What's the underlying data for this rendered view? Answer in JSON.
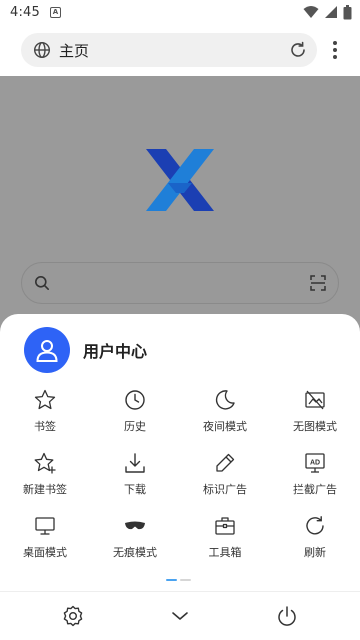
{
  "status_bar": {
    "time": "4:45",
    "notification_badge": "A"
  },
  "address_bar": {
    "title": "主页",
    "left_icon": "globe-icon",
    "right_icon": "refresh-icon"
  },
  "page": {
    "logo": "x-browser-logo",
    "search_placeholder": ""
  },
  "sheet": {
    "user": {
      "label": "用户中心",
      "avatar_icon": "user-icon"
    },
    "items": [
      {
        "label": "书签",
        "icon": "star-icon"
      },
      {
        "label": "历史",
        "icon": "clock-icon"
      },
      {
        "label": "夜间模式",
        "icon": "moon-icon"
      },
      {
        "label": "无图模式",
        "icon": "no-image-icon"
      },
      {
        "label": "新建书签",
        "icon": "star-plus-icon"
      },
      {
        "label": "下载",
        "icon": "download-icon"
      },
      {
        "label": "标识广告",
        "icon": "pencil-icon"
      },
      {
        "label": "拦截广告",
        "icon": "ad-block-icon"
      },
      {
        "label": "桌面模式",
        "icon": "monitor-icon"
      },
      {
        "label": "无痕模式",
        "icon": "mask-icon"
      },
      {
        "label": "工具箱",
        "icon": "toolbox-icon"
      },
      {
        "label": "刷新",
        "icon": "refresh-icon"
      }
    ],
    "pager": {
      "active_color": "#4aa3f0",
      "inactive_color": "#d6d6d6"
    },
    "bottom_bar": [
      "settings-icon",
      "chevron-down-icon",
      "power-icon"
    ]
  },
  "colors": {
    "accent": "#2e63f6",
    "overlay": "#9a9a9a"
  }
}
